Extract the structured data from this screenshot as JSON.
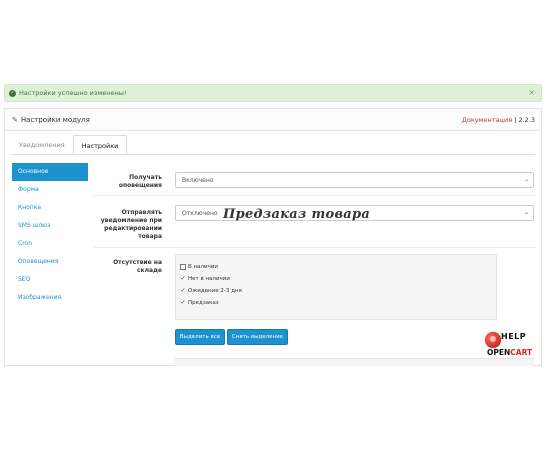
{
  "alert": {
    "message": "Настройки успешно изменены!",
    "close": "×"
  },
  "panel": {
    "title": "Настройки модуля",
    "doc_link": "Документация",
    "version_sep": " | ",
    "version": "2.2.3"
  },
  "tabs": [
    {
      "label": "Уведомления",
      "active": false
    },
    {
      "label": "Настройки",
      "active": true
    }
  ],
  "sidebar": {
    "items": [
      {
        "label": "Основное",
        "active": true
      },
      {
        "label": "Форма"
      },
      {
        "label": "Кнопка"
      },
      {
        "label": "SMS шлюз"
      },
      {
        "label": "Cron"
      },
      {
        "label": "Оповещения"
      },
      {
        "label": "SEO"
      },
      {
        "label": "Изображения"
      }
    ]
  },
  "fields": {
    "notify_label": "Получать оповещения",
    "notify_value": "Включено",
    "send_label": "Отправлять уведомление при редактировании товара",
    "send_value": "Отключено",
    "stock_label": "Отсутствие на складе",
    "stock_options": [
      {
        "label": "В наличии",
        "checked": false
      },
      {
        "label": "Нет в наличии",
        "checked": true
      },
      {
        "label": "Ожидание 2-3 дня",
        "checked": true
      },
      {
        "label": "Предзаказ",
        "checked": true
      }
    ],
    "select_all": "Выделить все",
    "deselect_all": "Снять выделение"
  },
  "watermark": "Предзаказ товара",
  "logo": {
    "top": "HELP",
    "bottom_a": "OPEN",
    "bottom_b": "CART"
  },
  "colors": {
    "accent": "#1e91cf",
    "success_bg": "#dff0d8",
    "success_text": "#3c763d",
    "doc_link": "#c0392b"
  }
}
